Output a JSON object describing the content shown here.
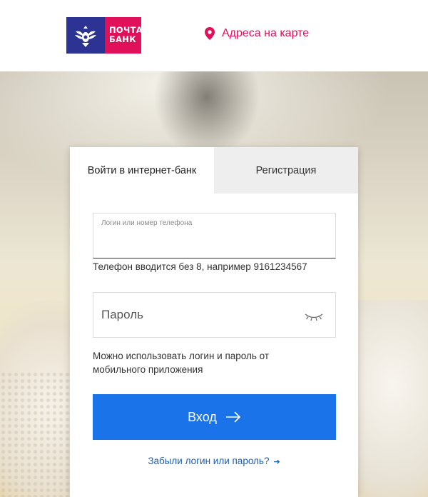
{
  "header": {
    "logo": {
      "line1": "ПОЧТА",
      "line2": "БАНК",
      "emblem_icon": "eagle-emblem-icon",
      "colors": {
        "emblem_bg": "#2d3393",
        "text_bg": "#e0105a"
      }
    },
    "map_link": {
      "label": "Адреса на карте",
      "icon": "map-pin-icon"
    }
  },
  "login_card": {
    "tabs": [
      {
        "label": "Войти в интернет-банк",
        "active": true
      },
      {
        "label": "Регистрация",
        "active": false
      }
    ],
    "login_field": {
      "placeholder": "Логин или номер телефона",
      "value": ""
    },
    "login_hint": "Телефон вводится без 8, например 9161234567",
    "password_field": {
      "placeholder": "Пароль",
      "value": "",
      "toggle_icon": "eye-closed-icon"
    },
    "password_hint": "Можно использовать логин и пароль от мобильного приложения",
    "submit_button": {
      "label": "Вход",
      "icon": "arrow-right-icon"
    },
    "forgot_link": {
      "label": "Забыли логин или пароль?",
      "icon": "small-arrow-right-icon"
    }
  },
  "colors": {
    "accent": "#e0105a",
    "primary_button": "#1a73e8",
    "link": "#1a5fb4"
  }
}
